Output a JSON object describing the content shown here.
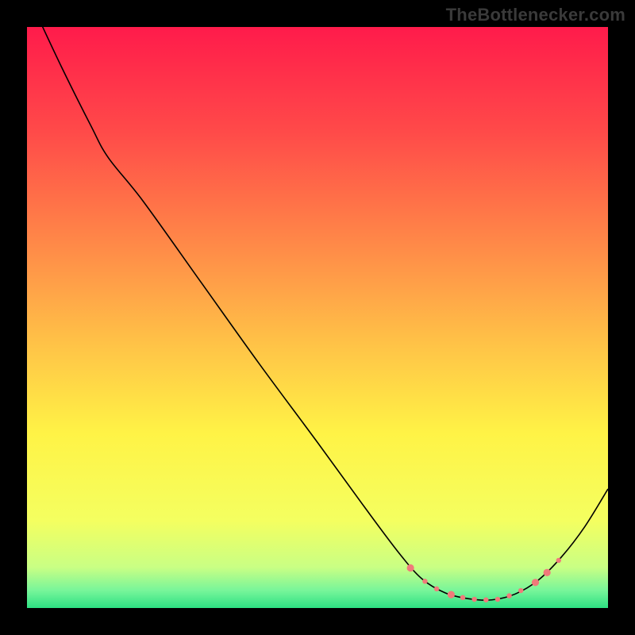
{
  "watermark": "TheBottlenecker.com",
  "chart_data": {
    "type": "line",
    "title": "",
    "xlabel": "",
    "ylabel": "",
    "xlim": [
      0,
      100
    ],
    "ylim": [
      0,
      100
    ],
    "background_gradient": {
      "stops": [
        {
          "offset": 0,
          "color": "#ff1b4b"
        },
        {
          "offset": 18,
          "color": "#ff4a49"
        },
        {
          "offset": 38,
          "color": "#ff8b48"
        },
        {
          "offset": 55,
          "color": "#ffc447"
        },
        {
          "offset": 70,
          "color": "#fff346"
        },
        {
          "offset": 85,
          "color": "#f4ff60"
        },
        {
          "offset": 93,
          "color": "#c9ff84"
        },
        {
          "offset": 97,
          "color": "#77f59a"
        },
        {
          "offset": 100,
          "color": "#2de183"
        }
      ]
    },
    "series": [
      {
        "name": "curve",
        "stroke": "#000000",
        "stroke_width": 1.6,
        "points": [
          {
            "x": 2.0,
            "y": 101.5
          },
          {
            "x": 6.0,
            "y": 93.0
          },
          {
            "x": 11.0,
            "y": 83.0
          },
          {
            "x": 14.0,
            "y": 77.5
          },
          {
            "x": 20.0,
            "y": 70.0
          },
          {
            "x": 30.0,
            "y": 56.0
          },
          {
            "x": 40.0,
            "y": 42.0
          },
          {
            "x": 50.0,
            "y": 28.5
          },
          {
            "x": 58.0,
            "y": 17.5
          },
          {
            "x": 64.0,
            "y": 9.5
          },
          {
            "x": 68.0,
            "y": 5.0
          },
          {
            "x": 72.0,
            "y": 2.6
          },
          {
            "x": 76.0,
            "y": 1.6
          },
          {
            "x": 80.0,
            "y": 1.4
          },
          {
            "x": 84.0,
            "y": 2.4
          },
          {
            "x": 88.0,
            "y": 4.8
          },
          {
            "x": 92.0,
            "y": 8.8
          },
          {
            "x": 96.0,
            "y": 14.0
          },
          {
            "x": 100.0,
            "y": 20.5
          }
        ]
      }
    ],
    "markers": {
      "name": "highlight-region",
      "fill": "#f07a7a",
      "radius_small": 3.2,
      "radius_large": 4.6,
      "points": [
        {
          "x": 66.0,
          "y": 6.9,
          "r": "large"
        },
        {
          "x": 68.5,
          "y": 4.6,
          "r": "small"
        },
        {
          "x": 70.5,
          "y": 3.3,
          "r": "small"
        },
        {
          "x": 73.0,
          "y": 2.3,
          "r": "large"
        },
        {
          "x": 75.0,
          "y": 1.8,
          "r": "small"
        },
        {
          "x": 77.0,
          "y": 1.5,
          "r": "small"
        },
        {
          "x": 79.0,
          "y": 1.4,
          "r": "small"
        },
        {
          "x": 81.0,
          "y": 1.5,
          "r": "small"
        },
        {
          "x": 83.0,
          "y": 2.1,
          "r": "small"
        },
        {
          "x": 85.0,
          "y": 3.0,
          "r": "small"
        },
        {
          "x": 87.5,
          "y": 4.4,
          "r": "large"
        },
        {
          "x": 89.5,
          "y": 6.1,
          "r": "large"
        },
        {
          "x": 91.5,
          "y": 8.2,
          "r": "small"
        }
      ]
    }
  }
}
